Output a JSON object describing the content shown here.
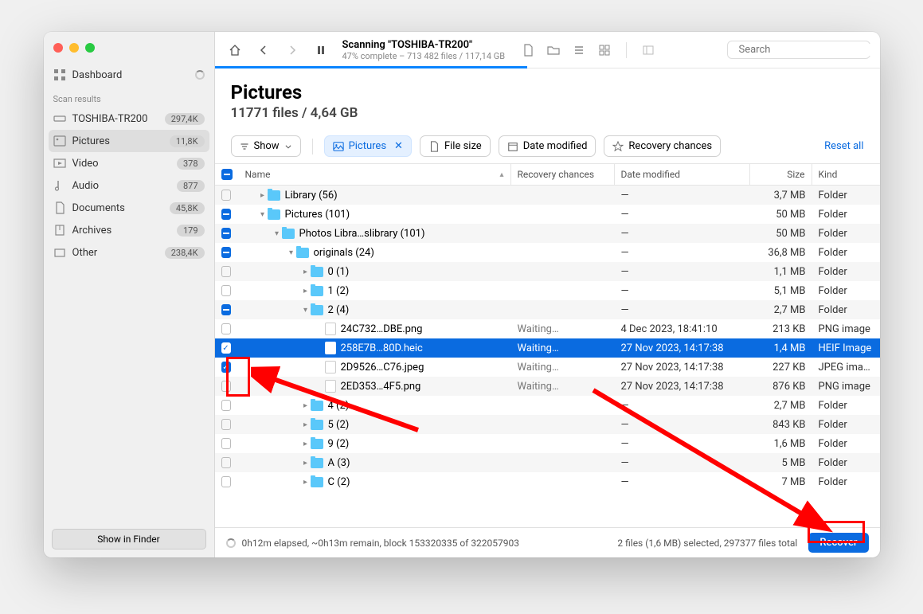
{
  "sidebar": {
    "dashboard_label": "Dashboard",
    "section_label": "Scan results",
    "drive": {
      "label": "TOSHIBA-TR200",
      "count": "297,4K"
    },
    "categories": [
      {
        "id": "pictures",
        "label": "Pictures",
        "count": "11,8K",
        "active": true
      },
      {
        "id": "video",
        "label": "Video",
        "count": "378"
      },
      {
        "id": "audio",
        "label": "Audio",
        "count": "877"
      },
      {
        "id": "documents",
        "label": "Documents",
        "count": "45,8K"
      },
      {
        "id": "archives",
        "label": "Archives",
        "count": "179"
      },
      {
        "id": "other",
        "label": "Other",
        "count": "238,4K"
      }
    ],
    "show_in_finder": "Show in Finder"
  },
  "toolbar": {
    "scan_title": "Scanning \"TOSHIBA-TR200\"",
    "scan_sub": "47% complete – 713 482 files / 117,14 GB",
    "progress_pct": 47,
    "search_placeholder": "Search"
  },
  "header": {
    "title": "Pictures",
    "subtitle": "11771 files / 4,64 GB"
  },
  "filters": {
    "show_label": "Show",
    "active_filter": "Pictures",
    "pills": [
      {
        "id": "filesize",
        "label": "File size"
      },
      {
        "id": "datemod",
        "label": "Date modified"
      },
      {
        "id": "recchance",
        "label": "Recovery chances"
      }
    ],
    "reset": "Reset all"
  },
  "columns": {
    "name": "Name",
    "recovery": "Recovery chances",
    "date": "Date modified",
    "size": "Size",
    "kind": "Kind"
  },
  "rows": [
    {
      "check": "empty",
      "indent": 0,
      "disc": "right",
      "type": "folder",
      "name": "Library (56)",
      "rec": "",
      "date": "—",
      "size": "3,7 MB",
      "kind": "Folder"
    },
    {
      "check": "minus",
      "indent": 0,
      "disc": "down",
      "type": "folder",
      "name": "Pictures (101)",
      "rec": "",
      "date": "—",
      "size": "50 MB",
      "kind": "Folder"
    },
    {
      "check": "minus",
      "indent": 1,
      "disc": "down",
      "type": "folder",
      "name": "Photos Libra…slibrary (101)",
      "rec": "",
      "date": "—",
      "size": "50 MB",
      "kind": "Folder"
    },
    {
      "check": "minus",
      "indent": 2,
      "disc": "down",
      "type": "folder",
      "name": "originals (24)",
      "rec": "",
      "date": "—",
      "size": "36,8 MB",
      "kind": "Folder"
    },
    {
      "check": "empty",
      "indent": 3,
      "disc": "right",
      "type": "folder",
      "name": "0 (1)",
      "rec": "",
      "date": "—",
      "size": "1,1 MB",
      "kind": "Folder"
    },
    {
      "check": "empty",
      "indent": 3,
      "disc": "right",
      "type": "folder",
      "name": "1 (2)",
      "rec": "",
      "date": "—",
      "size": "5,1 MB",
      "kind": "Folder"
    },
    {
      "check": "minus",
      "indent": 3,
      "disc": "down",
      "type": "folder",
      "name": "2 (4)",
      "rec": "",
      "date": "—",
      "size": "2,7 MB",
      "kind": "Folder"
    },
    {
      "check": "empty",
      "indent": 4,
      "disc": "",
      "type": "file",
      "name": "24C732…DBE.png",
      "rec": "Waiting…",
      "date": "4 Dec 2023, 18:41:10",
      "size": "213 KB",
      "kind": "PNG image"
    },
    {
      "check": "checked",
      "indent": 4,
      "disc": "",
      "type": "file",
      "name": "258E7B…80D.heic",
      "rec": "Waiting…",
      "date": "27 Nov 2023, 14:17:38",
      "size": "1,4 MB",
      "kind": "HEIF Image",
      "selected": true
    },
    {
      "check": "checked",
      "indent": 4,
      "disc": "",
      "type": "file",
      "name": "2D9526…C76.jpeg",
      "rec": "Waiting…",
      "date": "27 Nov 2023, 14:17:38",
      "size": "227 KB",
      "kind": "JPEG ima…"
    },
    {
      "check": "empty",
      "indent": 4,
      "disc": "",
      "type": "file",
      "name": "2ED353…4F5.png",
      "rec": "Waiting…",
      "date": "27 Nov 2023, 14:17:38",
      "size": "876 KB",
      "kind": "PNG image"
    },
    {
      "check": "empty",
      "indent": 3,
      "disc": "right",
      "type": "folder",
      "name": "4 (2)",
      "rec": "",
      "date": "—",
      "size": "2,7 MB",
      "kind": "Folder"
    },
    {
      "check": "empty",
      "indent": 3,
      "disc": "right",
      "type": "folder",
      "name": "5 (2)",
      "rec": "",
      "date": "—",
      "size": "843 KB",
      "kind": "Folder"
    },
    {
      "check": "empty",
      "indent": 3,
      "disc": "right",
      "type": "folder",
      "name": "9 (2)",
      "rec": "",
      "date": "—",
      "size": "1,6 MB",
      "kind": "Folder"
    },
    {
      "check": "empty",
      "indent": 3,
      "disc": "right",
      "type": "folder",
      "name": "A (3)",
      "rec": "",
      "date": "—",
      "size": "5 MB",
      "kind": "Folder"
    },
    {
      "check": "empty",
      "indent": 3,
      "disc": "right",
      "type": "folder",
      "name": "C (2)",
      "rec": "",
      "date": "—",
      "size": "7 MB",
      "kind": "Folder"
    }
  ],
  "footer": {
    "status": "0h12m elapsed, ~0h13m remain, block 153320335 of 322057903",
    "selection": "2 files (1,6 MB) selected, 297377 files total",
    "recover": "Recover"
  }
}
